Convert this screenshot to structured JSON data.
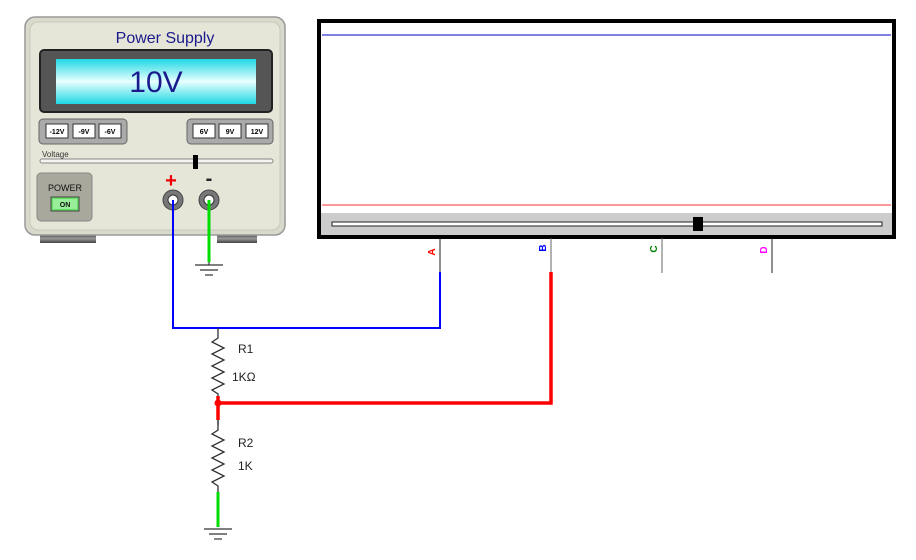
{
  "power_supply": {
    "title": "Power Supply",
    "display_value": "10V",
    "negative_presets": [
      "-12V",
      "-9V",
      "-6V"
    ],
    "positive_presets": [
      "6V",
      "9V",
      "12V"
    ],
    "voltage_label": "Voltage",
    "voltage_slider_fraction": 0.67,
    "power_label": "POWER",
    "power_button": "ON",
    "plus_terminal": "+",
    "minus_terminal": "-"
  },
  "oscilloscope": {
    "channels": [
      {
        "label": "A",
        "color": "#ff0000"
      },
      {
        "label": "B",
        "color": "#0000ff"
      },
      {
        "label": "C",
        "color": "#008000"
      },
      {
        "label": "D",
        "color": "#ff00ff"
      }
    ],
    "time_slider_fraction": 0.66
  },
  "circuit": {
    "r1_name": "R1",
    "r1_value": "1KΩ",
    "r2_name": "R2",
    "r2_value": "1K"
  },
  "colors": {
    "wire_a": "#0000ff",
    "wire_b": "#ff0000",
    "ground_wire": "#00dd00",
    "display": "#22e5ee",
    "text_title": "#1a1a8c"
  }
}
